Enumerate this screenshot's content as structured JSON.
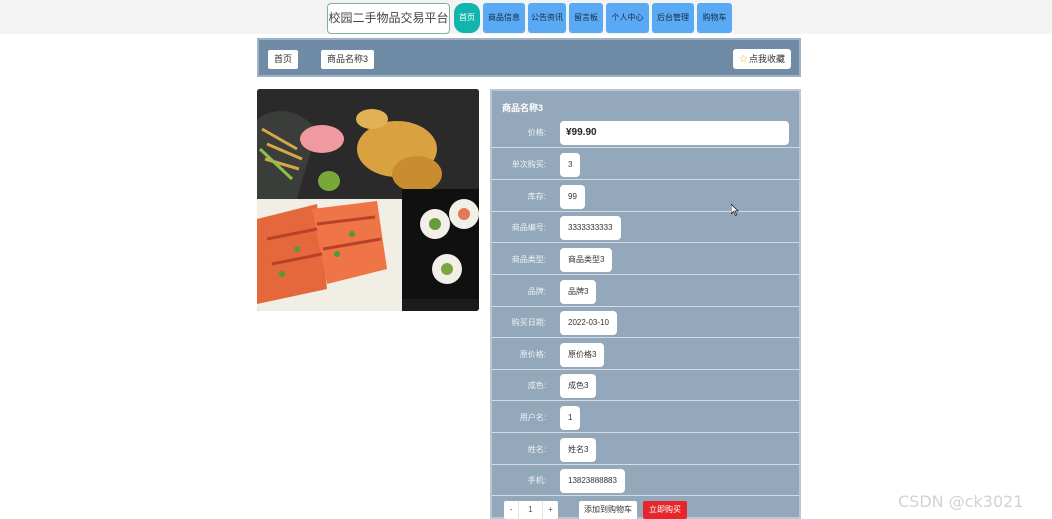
{
  "header": {
    "site_title": "校园二手物品交易平台",
    "nav": [
      "首页",
      "商品信息",
      "公告资讯",
      "留言板",
      "个人中心",
      "后台管理",
      "购物车"
    ]
  },
  "breadcrumb": {
    "home": "首页",
    "current": "商品名称3",
    "favorite_label": "点我收藏"
  },
  "product": {
    "title": "商品名称3",
    "image_icon": "food-bento-photo",
    "fields": [
      {
        "label": "价格:",
        "value": "¥99.90"
      },
      {
        "label": "单次购买:",
        "value": "3"
      },
      {
        "label": "库存:",
        "value": "99"
      },
      {
        "label": "商品编号:",
        "value": "3333333333"
      },
      {
        "label": "商品类型:",
        "value": "商品类型3"
      },
      {
        "label": "品牌:",
        "value": "品牌3"
      },
      {
        "label": "购买日期:",
        "value": "2022-03-10"
      },
      {
        "label": "原价格:",
        "value": "原价格3"
      },
      {
        "label": "成色:",
        "value": "成色3"
      },
      {
        "label": "用户名:",
        "value": "1"
      },
      {
        "label": "姓名:",
        "value": "姓名3"
      },
      {
        "label": "手机:",
        "value": "13823888883"
      }
    ]
  },
  "actions": {
    "minus": "-",
    "quantity": "1",
    "plus": "+",
    "add_to_cart": "添加到购物车",
    "buy_now": "立即购买"
  },
  "watermark": "CSDN @ck3021",
  "colors": {
    "nav_blue": "#5aa9f5",
    "nav_active": "#12b5ae",
    "panel": "#94a8bc",
    "buy_red": "#e6262a"
  }
}
